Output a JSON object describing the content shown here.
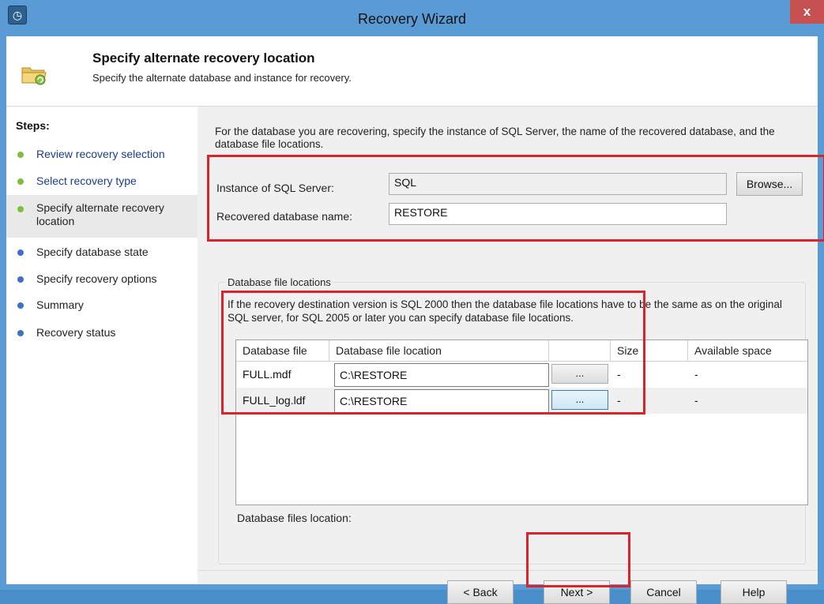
{
  "window": {
    "title": "Recovery Wizard",
    "close_glyph": "x"
  },
  "header": {
    "title": "Specify alternate recovery location",
    "subtitle": "Specify the alternate database and instance for recovery."
  },
  "steps": {
    "title": "Steps:",
    "items": [
      {
        "label": "Review recovery selection",
        "state": "done"
      },
      {
        "label": "Select recovery type",
        "state": "done"
      },
      {
        "label": "Specify alternate recovery location",
        "state": "current"
      },
      {
        "label": "Specify database state",
        "state": "pending"
      },
      {
        "label": "Specify recovery options",
        "state": "pending"
      },
      {
        "label": "Summary",
        "state": "pending"
      },
      {
        "label": "Recovery status",
        "state": "pending"
      }
    ]
  },
  "main": {
    "intro": "For the database you are recovering, specify the instance of SQL Server, the name of the recovered database, and the database file locations.",
    "instance_label": "Instance of SQL Server:",
    "instance_value": "SQL",
    "browse_label": "Browse...",
    "dbname_label": "Recovered database name:",
    "dbname_value": "RESTORE",
    "group_title": "Database file locations",
    "group_desc": "If the recovery destination version is SQL 2000 then the database file locations have to be the same as on the original SQL server, for SQL 2005 or later you can specify database file locations.",
    "grid": {
      "columns": [
        "Database file",
        "Database file location",
        "",
        "Size",
        "Available space"
      ],
      "rows": [
        {
          "file": "FULL.mdf",
          "location": "C:\\RESTORE",
          "browse": "...",
          "size": "-",
          "available": "-"
        },
        {
          "file": "FULL_log.ldf",
          "location": "C:\\RESTORE",
          "browse": "...",
          "size": "-",
          "available": "-"
        }
      ]
    },
    "files_location_label": "Database files location:"
  },
  "footer": {
    "back_label": "< Back",
    "next_label": "Next >",
    "cancel_label": "Cancel",
    "help_label": "Help"
  },
  "colors": {
    "title_bar": "#5b9bd5",
    "close_button": "#c75050",
    "highlight": "#d9242b",
    "step_done": "#7fbf3a",
    "step_pending": "#3f6fc6"
  },
  "icons": {
    "app": "recovery-wizard-icon",
    "header": "folder-restore-icon"
  }
}
